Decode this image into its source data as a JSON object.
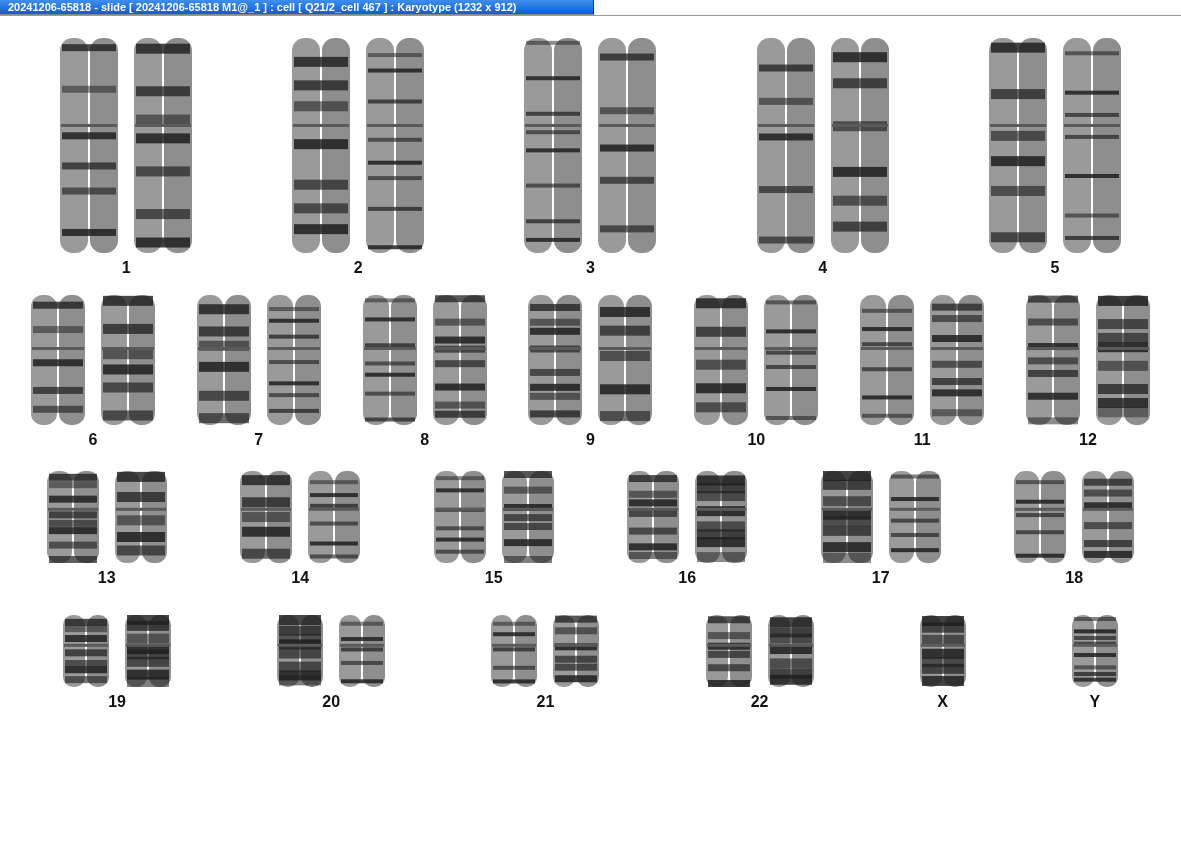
{
  "window": {
    "title": "20241206-65818 - slide [ 20241206-65818 M1@_1 ] : cell [ Q21/2_cell 467 ] : Karyotype  (1232 x 912)"
  },
  "rows": [
    {
      "groups": [
        {
          "label": "1",
          "kind": "pair"
        },
        {
          "label": "2",
          "kind": "pair"
        },
        {
          "label": "3",
          "kind": "pair"
        },
        {
          "label": "4",
          "kind": "pair"
        },
        {
          "label": "5",
          "kind": "pair"
        }
      ]
    },
    {
      "groups": [
        {
          "label": "6",
          "kind": "pair"
        },
        {
          "label": "7",
          "kind": "pair"
        },
        {
          "label": "8",
          "kind": "pair"
        },
        {
          "label": "9",
          "kind": "pair"
        },
        {
          "label": "10",
          "kind": "pair"
        },
        {
          "label": "11",
          "kind": "pair"
        },
        {
          "label": "12",
          "kind": "pair"
        }
      ]
    },
    {
      "groups": [
        {
          "label": "13",
          "kind": "pair"
        },
        {
          "label": "14",
          "kind": "pair"
        },
        {
          "label": "15",
          "kind": "pair"
        },
        {
          "label": "16",
          "kind": "pair"
        },
        {
          "label": "17",
          "kind": "pair"
        },
        {
          "label": "18",
          "kind": "pair"
        }
      ]
    },
    {
      "groups": [
        {
          "label": "19",
          "kind": "pair"
        },
        {
          "label": "20",
          "kind": "pair"
        },
        {
          "label": "21",
          "kind": "pair"
        },
        {
          "label": "22",
          "kind": "pair"
        },
        {
          "label": "X",
          "kind": "single"
        },
        {
          "label": "Y",
          "kind": "single"
        }
      ]
    }
  ]
}
